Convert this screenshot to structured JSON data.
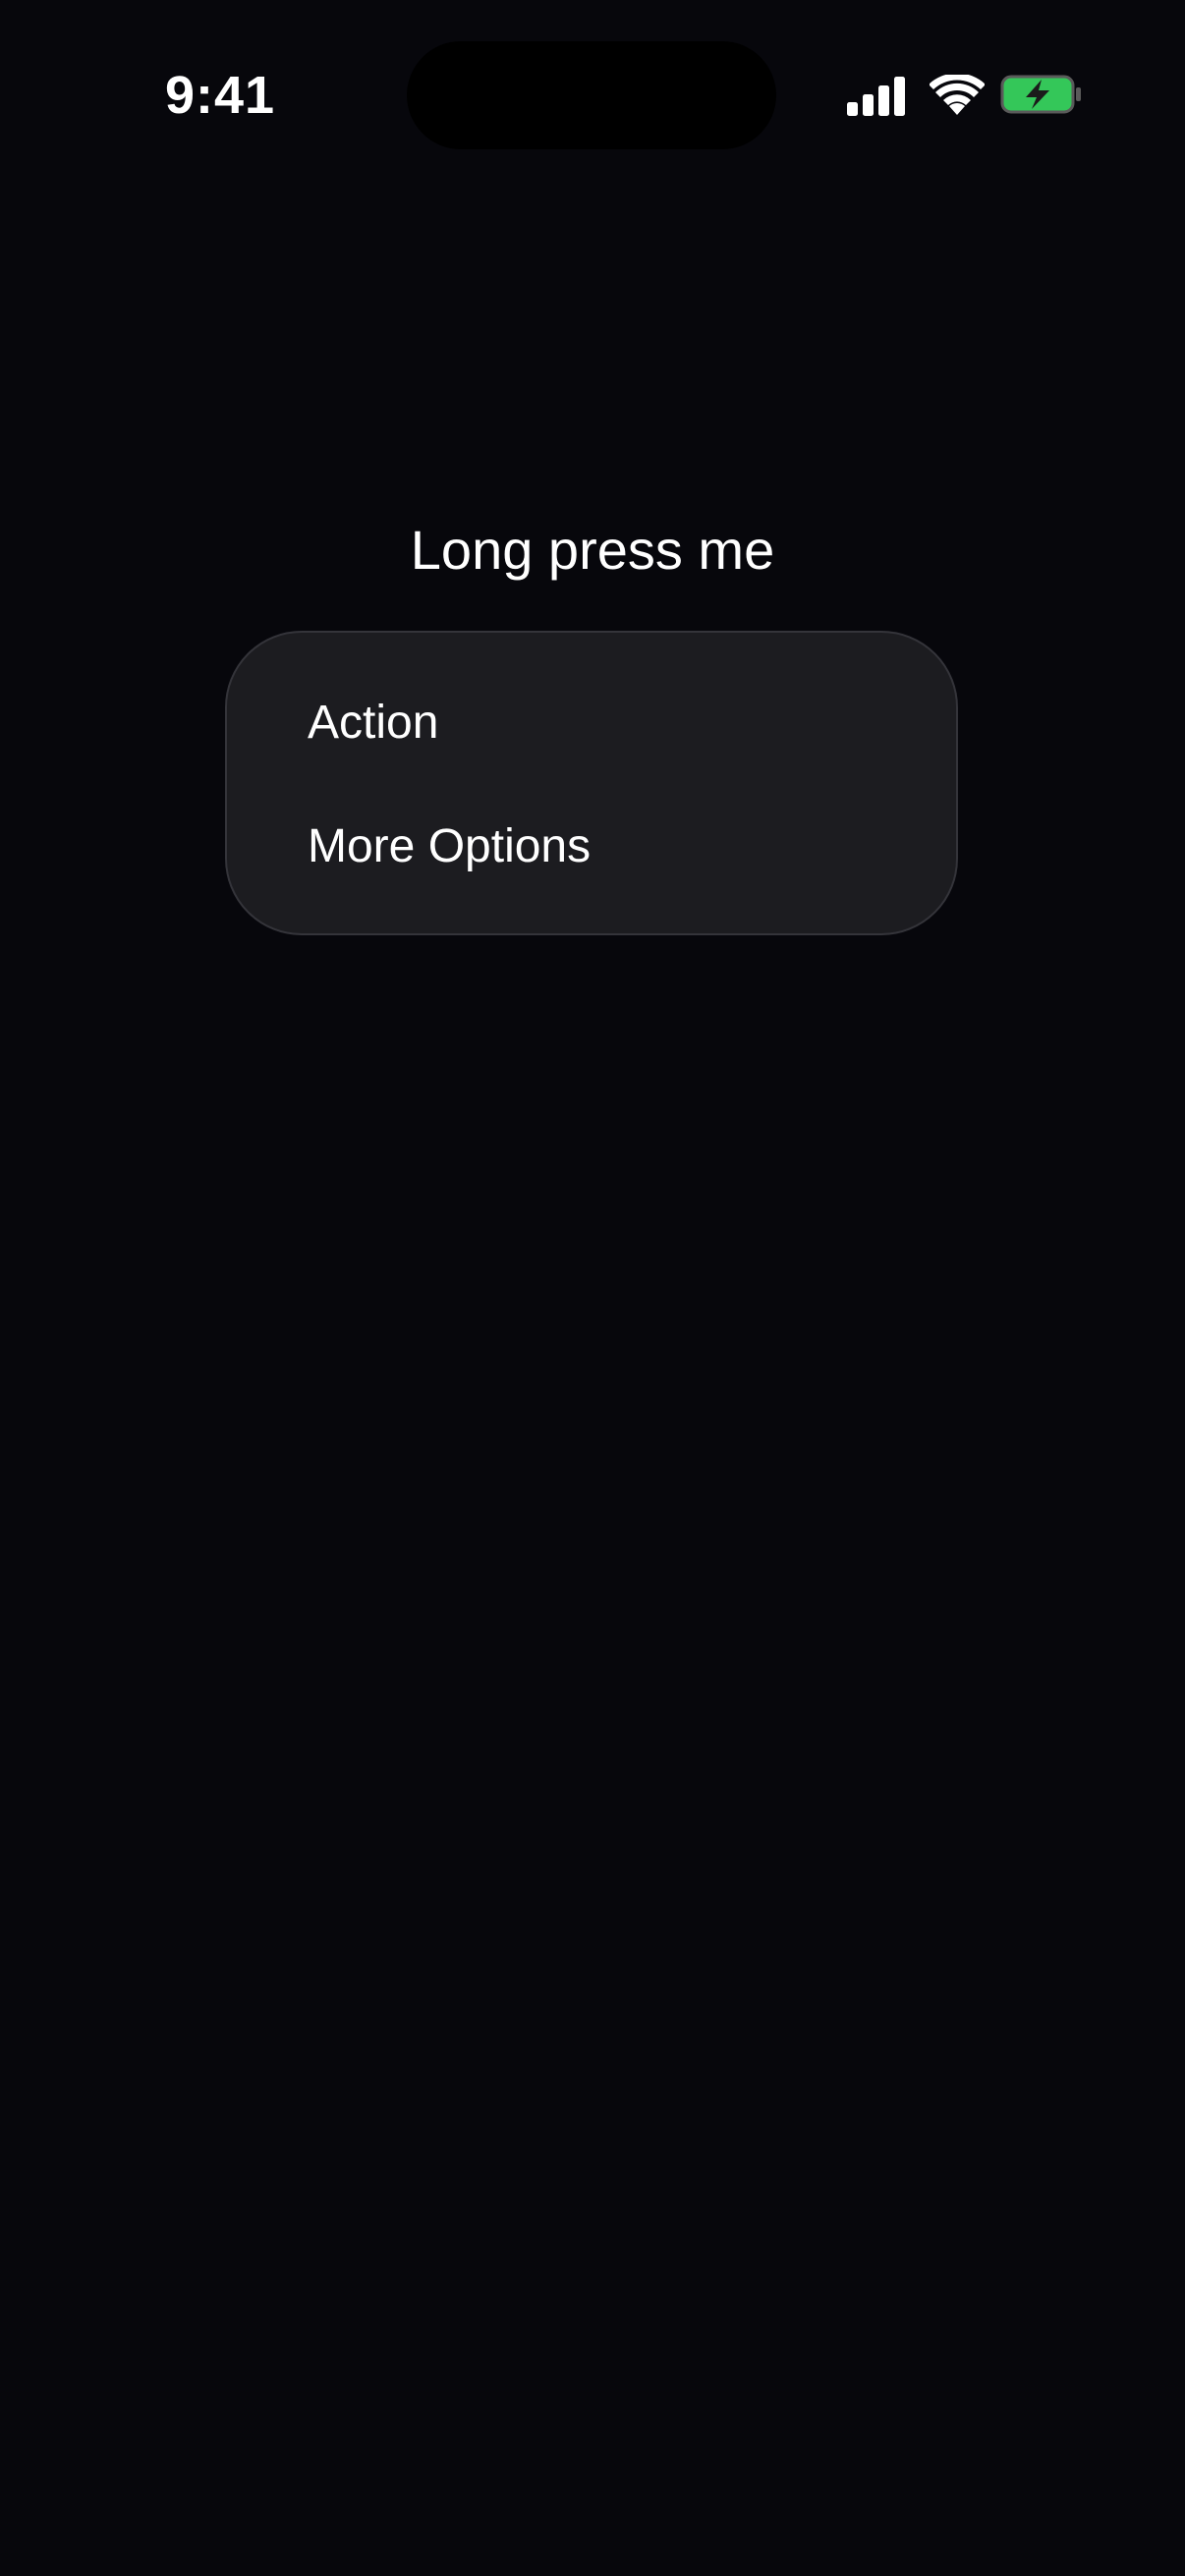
{
  "status_bar": {
    "time": "9:41",
    "icons": [
      "cellular-signal-icon",
      "wifi-icon",
      "battery-charging-icon"
    ],
    "battery_color": "#34c759"
  },
  "main": {
    "target_label": "Long press me"
  },
  "context_menu": {
    "items": [
      {
        "label": "Action"
      },
      {
        "label": "More Options"
      }
    ]
  },
  "colors": {
    "background": "#07070c",
    "menu_background": "#1c1c20",
    "menu_border": "#34343a",
    "text": "#ffffff"
  }
}
